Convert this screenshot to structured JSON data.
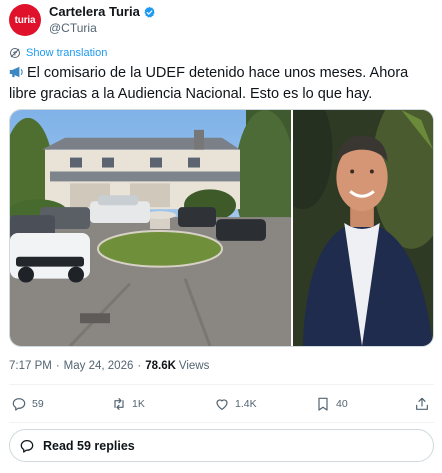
{
  "author": {
    "display_name": "Cartelera Turia",
    "handle": "@CTuria",
    "avatar_text": "turia",
    "avatar_color": "#e0112b",
    "verified": true,
    "verified_color": "#1d9bf0"
  },
  "translate": {
    "label": "Show translation",
    "icon": "translate-icon"
  },
  "tweet": {
    "emoji": "megaphone-emoji",
    "text": "El comisario de la UDEF detenido hace unos meses. Ahora libre gracias a la Audiencia Nacional. Esto es lo que hay."
  },
  "media": {
    "photos": [
      {
        "name": "house-driveway-photo"
      },
      {
        "name": "man-portrait-photo"
      }
    ]
  },
  "meta": {
    "time": "7:17 PM",
    "separator": "·",
    "date": "May 24, 2026",
    "views_count": "78.6K",
    "views_label": "Views"
  },
  "actions": {
    "reply": {
      "count": "59",
      "icon": "reply-icon"
    },
    "repost": {
      "count": "1K",
      "icon": "repost-icon"
    },
    "like": {
      "count": "1.4K",
      "icon": "heart-icon"
    },
    "bookmark": {
      "count": "40",
      "icon": "bookmark-icon"
    },
    "share": {
      "icon": "share-icon"
    }
  },
  "replies": {
    "label": "Read 59 replies",
    "icon": "reply-icon"
  },
  "colors": {
    "accent": "#1d9bf0",
    "text": "#0f1419",
    "secondary": "#536471",
    "border": "#cfd9de"
  }
}
